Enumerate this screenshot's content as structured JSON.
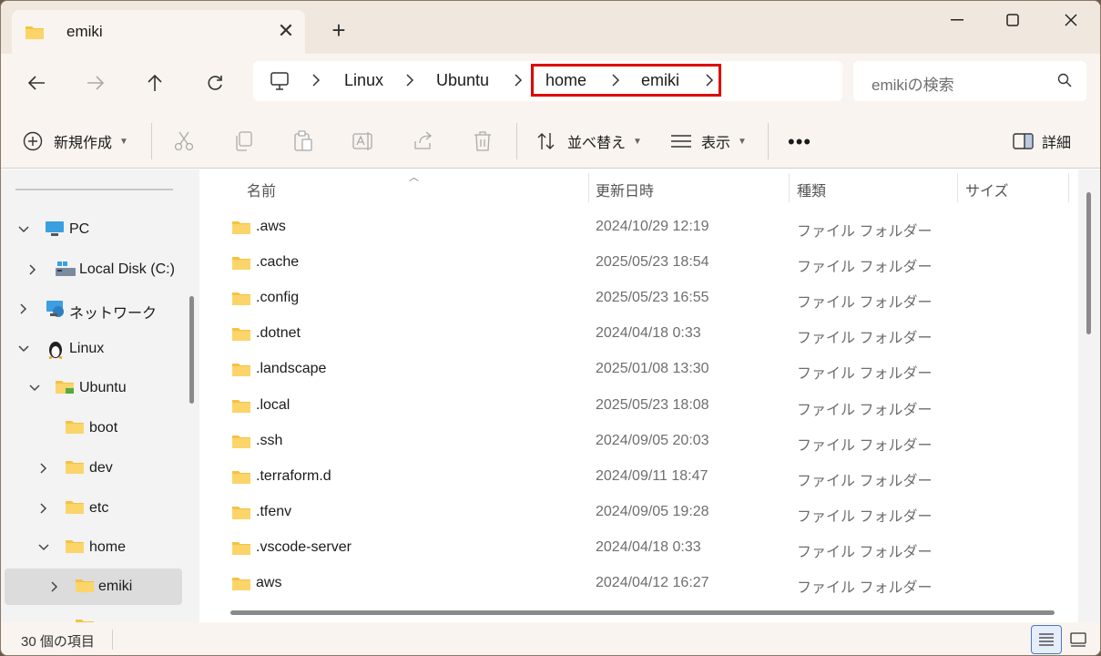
{
  "tab": {
    "title": "emiki"
  },
  "window_controls": [
    "minimize",
    "maximize",
    "close"
  ],
  "address": {
    "crumbs": [
      "Linux",
      "Ubuntu",
      "home",
      "emiki"
    ],
    "highlight_color": "#e00000"
  },
  "search": {
    "placeholder": "emikiの検索"
  },
  "commands": {
    "new": "新規作成",
    "sort": "並べ替え",
    "view": "表示",
    "details": "詳細"
  },
  "sidebar": {
    "items": [
      {
        "label": "PC"
      },
      {
        "label": "Local Disk (C:)"
      },
      {
        "label": "ネットワーク"
      },
      {
        "label": "Linux"
      },
      {
        "label": "Ubuntu"
      },
      {
        "label": "boot"
      },
      {
        "label": "dev"
      },
      {
        "label": "etc"
      },
      {
        "label": "home"
      },
      {
        "label": "emiki"
      }
    ]
  },
  "columns": {
    "name": "名前",
    "date": "更新日時",
    "type": "種類",
    "size": "サイズ"
  },
  "files": [
    {
      "name": ".aws",
      "date": "2024/10/29 12:19",
      "type": "ファイル フォルダー"
    },
    {
      "name": ".cache",
      "date": "2025/05/23 18:54",
      "type": "ファイル フォルダー"
    },
    {
      "name": ".config",
      "date": "2025/05/23 16:55",
      "type": "ファイル フォルダー"
    },
    {
      "name": ".dotnet",
      "date": "2024/04/18 0:33",
      "type": "ファイル フォルダー"
    },
    {
      "name": ".landscape",
      "date": "2025/01/08 13:30",
      "type": "ファイル フォルダー"
    },
    {
      "name": ".local",
      "date": "2025/05/23 18:08",
      "type": "ファイル フォルダー"
    },
    {
      "name": ".ssh",
      "date": "2024/09/05 20:03",
      "type": "ファイル フォルダー"
    },
    {
      "name": ".terraform.d",
      "date": "2024/09/11 18:47",
      "type": "ファイル フォルダー"
    },
    {
      "name": ".tfenv",
      "date": "2024/09/05 19:28",
      "type": "ファイル フォルダー"
    },
    {
      "name": ".vscode-server",
      "date": "2024/04/18 0:33",
      "type": "ファイル フォルダー"
    },
    {
      "name": "aws",
      "date": "2024/04/12 16:27",
      "type": "ファイル フォルダー"
    }
  ],
  "status": {
    "count": "30 個の項目"
  },
  "colors": {
    "folder": "#f5c242",
    "accent": "#4a78c2"
  }
}
